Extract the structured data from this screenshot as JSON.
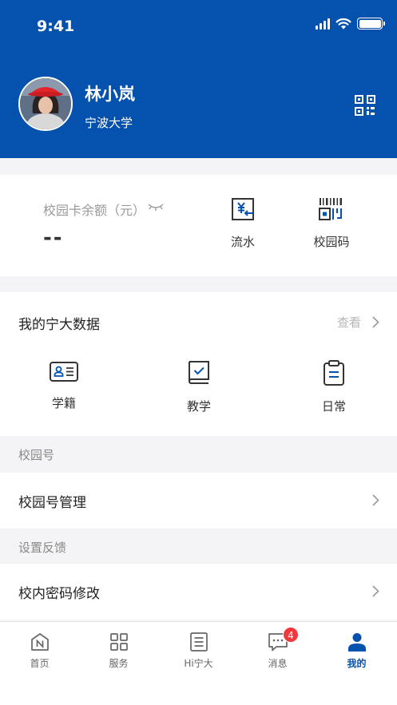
{
  "status_bar": {
    "time": "9:41"
  },
  "profile": {
    "name": "林小岚",
    "school": "宁波大学"
  },
  "balance": {
    "label": "校园卡余额（元）",
    "value": "--"
  },
  "quick_actions": [
    {
      "label": "流水",
      "icon": "yuan-transfer-icon"
    },
    {
      "label": "校园码",
      "icon": "barcode-icon"
    }
  ],
  "data_section": {
    "title": "我的宁大数据",
    "more_label": "查看",
    "items": [
      {
        "label": "学籍",
        "icon": "id-card-icon"
      },
      {
        "label": "教学",
        "icon": "book-check-icon"
      },
      {
        "label": "日常",
        "icon": "clipboard-icon"
      }
    ]
  },
  "sections": [
    {
      "header": "校园号",
      "row": "校园号管理"
    },
    {
      "header": "设置反馈",
      "row": "校内密码修改"
    }
  ],
  "tabbar": {
    "items": [
      {
        "label": "首页",
        "icon": "home-n-icon"
      },
      {
        "label": "服务",
        "icon": "grid-icon"
      },
      {
        "label": "Hi宁大",
        "icon": "list-doc-icon"
      },
      {
        "label": "消息",
        "icon": "chat-icon",
        "badge": "4"
      },
      {
        "label": "我的",
        "icon": "person-icon"
      }
    ],
    "active_index": 4
  },
  "colors": {
    "brand": "#0452ad",
    "badge": "#f0393e"
  }
}
